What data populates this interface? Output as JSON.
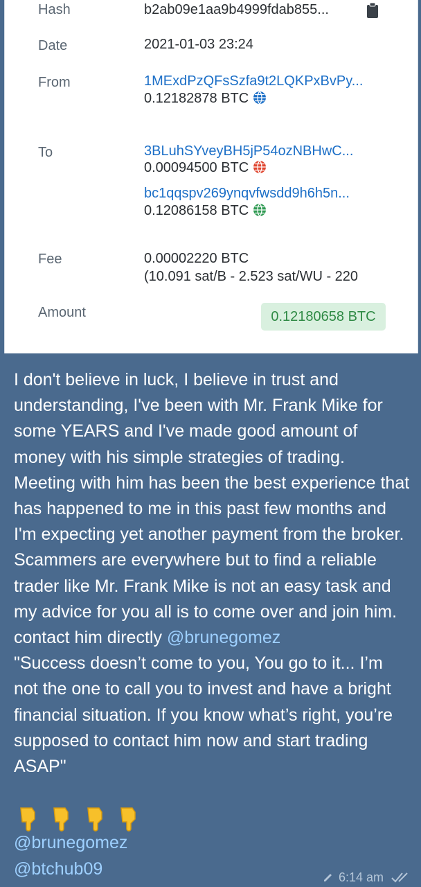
{
  "transaction": {
    "hash_label": "Hash",
    "hash_value": "b2ab09e1aa9b4999fdab855...",
    "date_label": "Date",
    "date_value": "2021-01-03 23:24",
    "from_label": "From",
    "from_address": "1MExdPzQFsSzfa9t2LQKPxBvPy...",
    "from_amount": "0.12182878 BTC",
    "to_label": "To",
    "to_outputs": [
      {
        "address": "3BLuhSYveyBH5jP54ozNBHwC...",
        "amount": "0.00094500 BTC",
        "globe_color": "#e0452f"
      },
      {
        "address": "bc1qqspv269ynqvfwsdd9h6h5n...",
        "amount": "0.12086158 BTC",
        "globe_color": "#2f9a52"
      }
    ],
    "from_globe_color": "#1c6fc7",
    "fee_label": "Fee",
    "fee_value": "0.00002220 BTC",
    "fee_detail": "(10.091 sat/B - 2.523 sat/WU - 220",
    "amount_label": "Amount",
    "amount_value": "0.12180658 BTC"
  },
  "message": {
    "text": "I don't believe in luck, I believe in trust and understanding, I've been with Mr. Frank Mike for some YEARS and I've made good amount of money with his simple strategies of trading. Meeting with him has been the best experience that has happened to me in this past few months and I'm expecting yet another payment from the broker. Scammers are everywhere but to find a reliable trader like Mr. Frank Mike is not an easy task and my advice for you all is to come over and join him. contact him directly ",
    "inline_mention": "@brunegomez",
    "quote": "\"Success doesn’t come to you, You go to it... I’m not the one to call you to invest and have a bright financial situation. If you know what’s right, you’re supposed to contact him now and start trading ASAP\"",
    "emoji": [
      "pointing-down",
      "pointing-down",
      "pointing-down",
      "pointing-down"
    ],
    "tag_1": "@brunegomez",
    "tag_2": "@btchub09",
    "time": "6:14 am",
    "status": "read"
  },
  "colors": {
    "background": "#4a6a8e",
    "link": "#1c6fc7",
    "mention": "#9ed0ff",
    "amount_badge": "#d9f0df"
  }
}
